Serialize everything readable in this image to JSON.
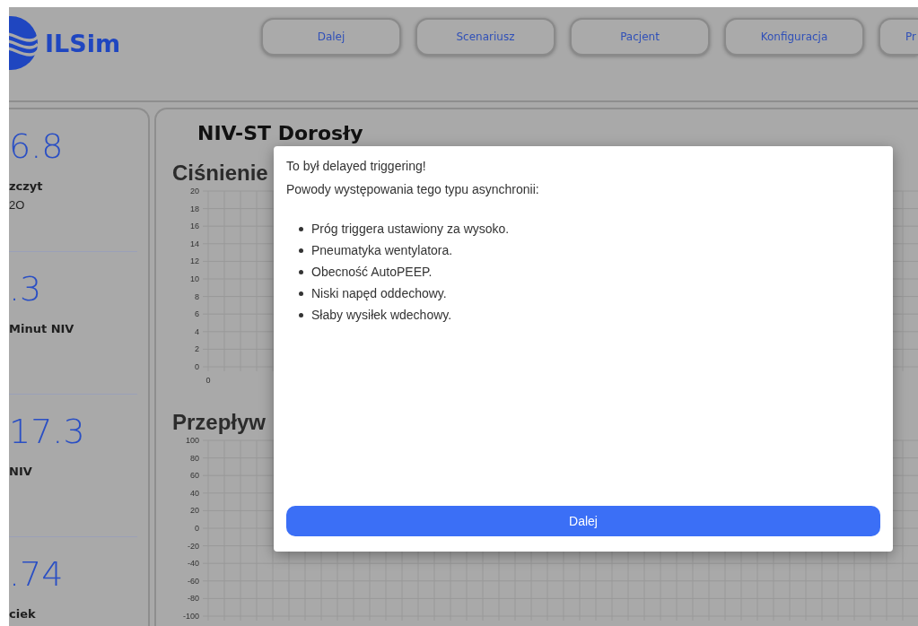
{
  "logo": {
    "name": "ILSim"
  },
  "nav": [
    "Dalej",
    "Scenariusz",
    "Pacjent",
    "Konfiguracja",
    "Pr"
  ],
  "stats": [
    {
      "value": "6.8",
      "label": "zczyt",
      "unit": "2O"
    },
    {
      "value": ".3",
      "label": "Minut NIV"
    },
    {
      "value": "17.3",
      "label": "NIV"
    },
    {
      "value": ".74",
      "label": "ciek"
    }
  ],
  "mode_title": "NIV-ST Dorosły",
  "charts": [
    {
      "title": "Ciśnienie",
      "y_labels": [
        "20",
        "18",
        "16",
        "14",
        "12",
        "10",
        "8",
        "6",
        "4",
        "2",
        "0"
      ],
      "x_labels": [
        "0"
      ]
    },
    {
      "title": "Przepływ",
      "y_labels": [
        "100",
        "80",
        "60",
        "40",
        "20",
        "0",
        "-20",
        "-40",
        "-60",
        "-80",
        "-100"
      ]
    }
  ],
  "dialog": {
    "heading": "To był delayed triggering!",
    "intro": "Powody występowania tego typu asynchronii:",
    "reasons": [
      "Próg triggera ustawiony za wysoko.",
      "Pneumatyka wentylatora.",
      "Obecność AutoPEEP.",
      "Niski napęd oddechowy.",
      "Słaby wysiłek wdechowy."
    ],
    "button": "Dalej"
  }
}
